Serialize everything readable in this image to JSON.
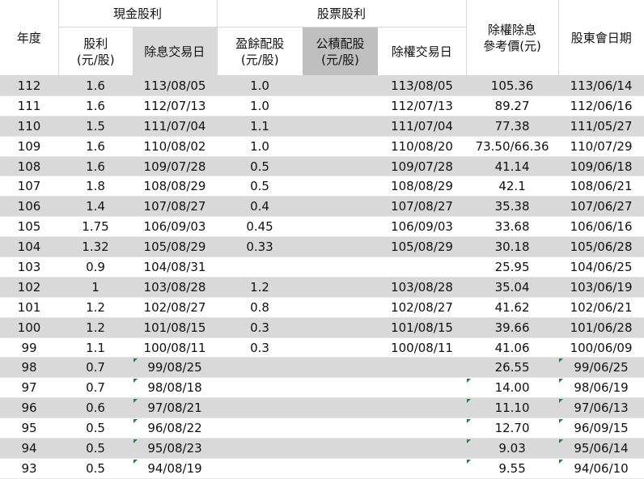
{
  "headers": {
    "year": "年度",
    "cash_group": "現金股利",
    "stock_group": "股票股利",
    "cash_dividend": [
      "股利",
      "(元/股)"
    ],
    "ex_dividend_date": "除息交易日",
    "earnings_stock": [
      "盈餘配股",
      "(元/股)"
    ],
    "reserve_stock": [
      "公積配股",
      "(元/股)"
    ],
    "ex_rights_date": "除權交易日",
    "ref_price": [
      "除權除息",
      "參考價(元)"
    ],
    "agm_date": "股東會日期"
  },
  "rows": [
    {
      "year": "112",
      "cash": "1.6",
      "ex_div": "113/08/05",
      "earn": "1.0",
      "reserve": "",
      "ex_rights": "113/08/05",
      "ref": "105.36",
      "agm": "113/06/14"
    },
    {
      "year": "111",
      "cash": "1.6",
      "ex_div": "112/07/13",
      "earn": "1.0",
      "reserve": "",
      "ex_rights": "112/07/13",
      "ref": "89.27",
      "agm": "112/06/16"
    },
    {
      "year": "110",
      "cash": "1.5",
      "ex_div": "111/07/04",
      "earn": "1.1",
      "reserve": "",
      "ex_rights": "111/07/04",
      "ref": "77.38",
      "agm": "111/05/27"
    },
    {
      "year": "109",
      "cash": "1.6",
      "ex_div": "110/08/02",
      "earn": "1.0",
      "reserve": "",
      "ex_rights": "110/08/20",
      "ref": "73.50/66.36",
      "agm": "110/07/29"
    },
    {
      "year": "108",
      "cash": "1.6",
      "ex_div": "109/07/28",
      "earn": "0.5",
      "reserve": "",
      "ex_rights": "109/07/28",
      "ref": "41.14",
      "agm": "109/06/18"
    },
    {
      "year": "107",
      "cash": "1.8",
      "ex_div": "108/08/29",
      "earn": "0.5",
      "reserve": "",
      "ex_rights": "108/08/29",
      "ref": "42.1",
      "agm": "108/06/21"
    },
    {
      "year": "106",
      "cash": "1.4",
      "ex_div": "107/08/27",
      "earn": "0.4",
      "reserve": "",
      "ex_rights": "107/08/27",
      "ref": "35.38",
      "agm": "107/06/27"
    },
    {
      "year": "105",
      "cash": "1.75",
      "ex_div": "106/09/03",
      "earn": "0.45",
      "reserve": "",
      "ex_rights": "106/09/03",
      "ref": "33.68",
      "agm": "106/06/16"
    },
    {
      "year": "104",
      "cash": "1.32",
      "ex_div": "105/08/29",
      "earn": "0.33",
      "reserve": "",
      "ex_rights": "105/08/29",
      "ref": "30.18",
      "agm": "105/06/28"
    },
    {
      "year": "103",
      "cash": "0.9",
      "ex_div": "104/08/31",
      "earn": "",
      "reserve": "",
      "ex_rights": "",
      "ref": "25.95",
      "agm": "104/06/25"
    },
    {
      "year": "102",
      "cash": "1",
      "ex_div": "103/08/28",
      "earn": "1.2",
      "reserve": "",
      "ex_rights": "103/08/28",
      "ref": "35.04",
      "agm": "103/06/19"
    },
    {
      "year": "101",
      "cash": "1.2",
      "ex_div": "102/08/27",
      "earn": "0.8",
      "reserve": "",
      "ex_rights": "102/08/27",
      "ref": "41.62",
      "agm": "102/06/21"
    },
    {
      "year": "100",
      "cash": "1.2",
      "ex_div": "101/08/15",
      "earn": "0.3",
      "reserve": "",
      "ex_rights": "101/08/15",
      "ref": "39.66",
      "agm": "101/06/28"
    },
    {
      "year": "99",
      "cash": "1.1",
      "ex_div": "100/08/11",
      "earn": "0.3",
      "reserve": "",
      "ex_rights": "100/08/11",
      "ref": "41.06",
      "agm": "100/06/09"
    },
    {
      "year": "98",
      "cash": "0.7",
      "ex_div": "99/08/25",
      "earn": "",
      "reserve": "",
      "ex_rights": "",
      "ref": "26.55",
      "agm": "99/06/25"
    },
    {
      "year": "97",
      "cash": "0.7",
      "ex_div": "98/08/18",
      "earn": "",
      "reserve": "",
      "ex_rights": "",
      "ref": "14.00",
      "agm": "98/06/19"
    },
    {
      "year": "96",
      "cash": "0.6",
      "ex_div": "97/08/21",
      "earn": "",
      "reserve": "",
      "ex_rights": "",
      "ref": "11.10",
      "agm": "97/06/13"
    },
    {
      "year": "95",
      "cash": "0.5",
      "ex_div": "96/08/22",
      "earn": "",
      "reserve": "",
      "ex_rights": "",
      "ref": "12.70",
      "agm": "96/09/15"
    },
    {
      "year": "94",
      "cash": "0.5",
      "ex_div": "95/08/23",
      "earn": "",
      "reserve": "",
      "ex_rights": "",
      "ref": "9.03",
      "agm": "95/06/14"
    },
    {
      "year": "93",
      "cash": "0.5",
      "ex_div": "94/08/19",
      "earn": "",
      "reserve": "",
      "ex_rights": "",
      "ref": "9.55",
      "agm": "94/06/10"
    }
  ]
}
